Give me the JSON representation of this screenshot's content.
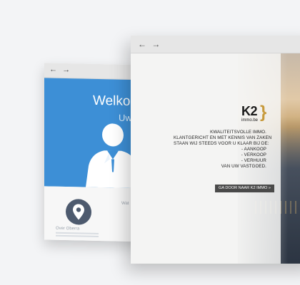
{
  "back_window": {
    "nav": {
      "back": "←",
      "forward": "→"
    },
    "hero_title": "Welkom",
    "hero_subtitle": "Uw",
    "feature1_label": "Over Oberra",
    "feature2_label": "Wat"
  },
  "front_window": {
    "nav": {
      "back": "←",
      "forward": "→"
    },
    "logo": {
      "mark": "K2",
      "sub": "immo.be",
      "brace": "}"
    },
    "tagline": [
      "Kwaliteitsvolle immo.",
      "Klantgericht en met kennis van zaken",
      "staan wij steeds voor u klaar bij de:",
      "- Aankoop",
      "- Verkoop",
      "- Verhuur",
      "van uw vastgoed."
    ],
    "cta_label": "GA DOOR NAAR K2 IMMO »"
  },
  "colors": {
    "page_background": "#f3f4f6",
    "chrome": "#e6e6e6",
    "back_hero_blue": "#3d8fd6",
    "pin_circle": "#4d5a6e",
    "logo_accent_gold": "#c79a3c",
    "cta_background": "#4a4a4a"
  },
  "icons": [
    "back-arrow-icon",
    "forward-arrow-icon",
    "location-pin-icon",
    "person-silhouette-icon"
  ]
}
